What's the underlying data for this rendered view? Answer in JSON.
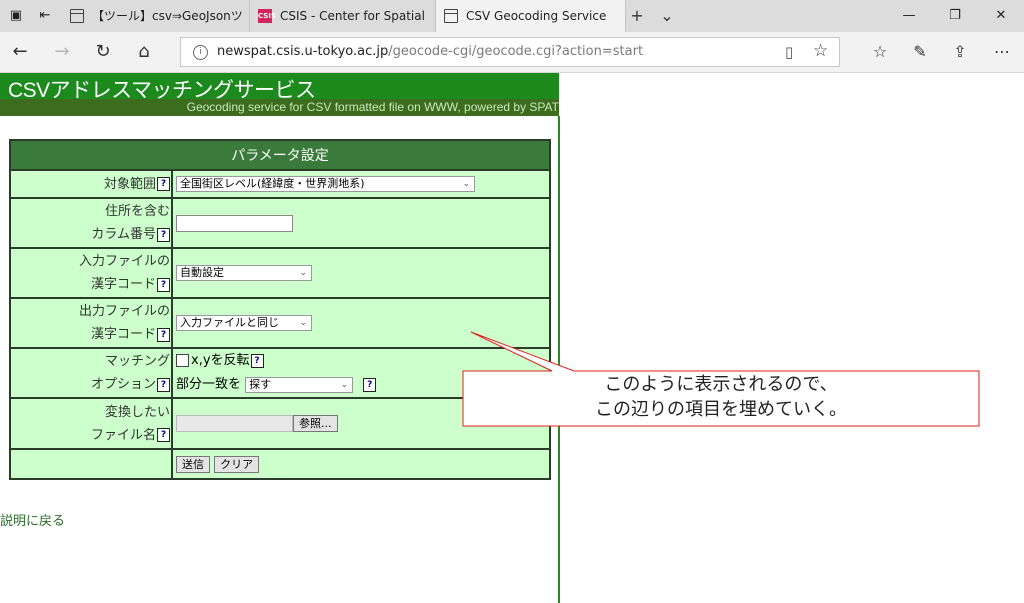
{
  "browser": {
    "tabs": [
      {
        "title": "【ツール】csv⇒GeoJsonツール |",
        "active": false
      },
      {
        "title": "CSIS - Center for Spatial Inf",
        "active": false,
        "favicon_text": "CSIS"
      },
      {
        "title": "CSV Geocoding Service",
        "active": true
      }
    ],
    "new_tab": "+",
    "tab_list": "⌄",
    "window_controls": [
      "—",
      "❐",
      "✕"
    ],
    "url_host": "newspat.csis.u-tokyo.ac.jp",
    "url_path": "/geocode-cgi/geocode.cgi?action=start"
  },
  "page": {
    "banner_title": "CSVアドレスマッチングサービス",
    "banner_subtitle": "Geocoding service for CSV formatted file on WWW, powered by SPAT",
    "table_header": "パラメータ設定",
    "help": "?",
    "rows": {
      "scope_label": "対象範囲",
      "scope_value": "全国街区レベル(経緯度・世界測地系)",
      "address_col_label_1": "住所を含む",
      "address_col_label_2": "カラム番号",
      "input_enc_label_1": "入力ファイルの",
      "input_enc_label_2": "漢字コード",
      "input_enc_value": "自動設定",
      "output_enc_label_1": "出力ファイルの",
      "output_enc_label_2": "漢字コード",
      "output_enc_value": "入力ファイルと同じ",
      "matching_label_1": "マッチング",
      "matching_label_2": "オプション",
      "swap_xy_label": "x,yを反転",
      "partial_match_label": "部分一致を",
      "partial_match_value": "探す",
      "file_label_1": "変換したい",
      "file_label_2": "ファイル名",
      "browse_button": "参照...",
      "submit_button": "送信",
      "clear_button": "クリア"
    },
    "back_link": "説明に戻る"
  },
  "callout": {
    "line1": "このように表示されるので、",
    "line2": "この辺りの項目を埋めていく。",
    "border_color": "#e0201c"
  }
}
